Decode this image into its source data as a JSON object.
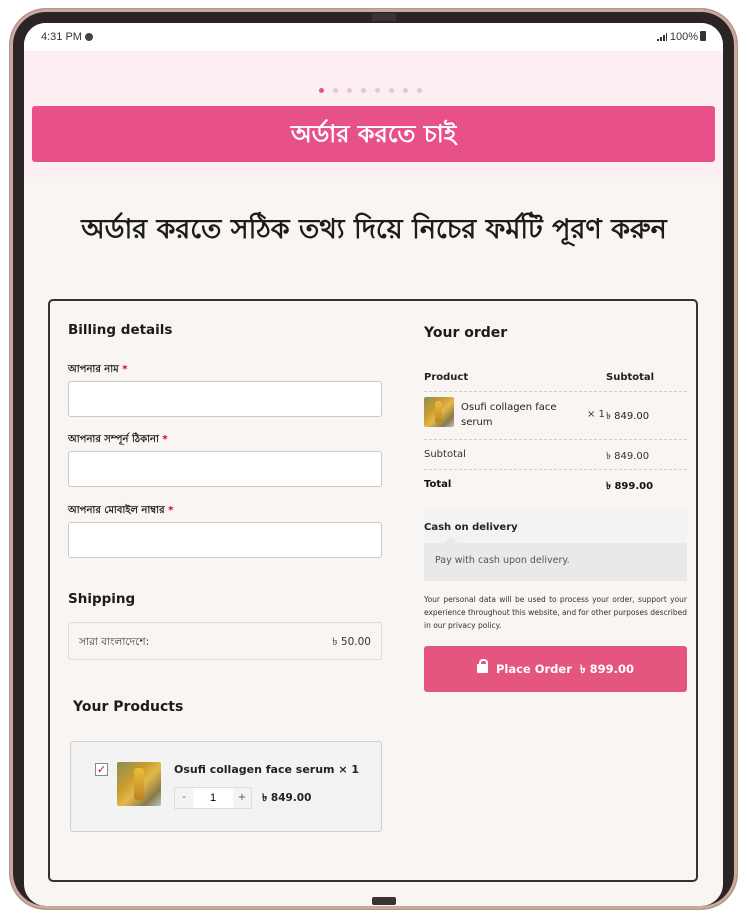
{
  "status_bar": {
    "time": "4:31 PM",
    "battery": "100%"
  },
  "carousel": {
    "dot_count": 8,
    "active_index": 0
  },
  "banner": {
    "cta_label": "অর্ডার করতে চাই"
  },
  "headline": "অর্ডার করতে সঠিক তথ্য দিয়ে নিচের ফর্মটি পূরণ করুন",
  "billing": {
    "title": "Billing details",
    "fields": [
      {
        "label": "আপনার নাম",
        "required": "*",
        "value": ""
      },
      {
        "label": "আপনার সম্পূর্ন ঠিকানা",
        "required": "*",
        "value": ""
      },
      {
        "label": "আপনার মোবাইল নাম্বার",
        "required": "*",
        "value": ""
      }
    ]
  },
  "shipping": {
    "title": "Shipping",
    "label": "সারা বাংলাদেশে:",
    "price": "৳ 50.00"
  },
  "products": {
    "title": "Your Products",
    "item": {
      "checked": true,
      "name": "Osufi collagen face serum",
      "qty_label": "× 1",
      "qty": "1",
      "minus": "-",
      "plus": "+",
      "price": "৳ 849.00"
    }
  },
  "order": {
    "title": "Your order",
    "col_product": "Product",
    "col_subtotal": "Subtotal",
    "item": {
      "name": "Osufi collagen face serum",
      "qty": "× 1",
      "price": "৳ 849.00"
    },
    "subtotal_label": "Subtotal",
    "subtotal_value": "৳ 849.00",
    "total_label": "Total",
    "total_value": "৳ 899.00"
  },
  "payment": {
    "title": "Cash on delivery",
    "description": "Pay with cash upon delivery."
  },
  "privacy_text": "Your personal data will be used to process your order, support your experience throughout this website, and for other purposes described in our privacy policy.",
  "place_order": {
    "label": "Place Order",
    "amount": "৳ 899.00"
  },
  "colors": {
    "brand_pink": "#e8508a",
    "button_pink": "#e5567f",
    "banner_bg": "#fdeef2"
  }
}
